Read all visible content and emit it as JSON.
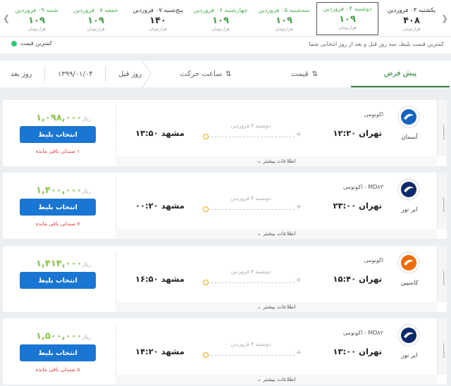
{
  "date_strip": {
    "prev_arrow": "❮",
    "next_arrow": "❯",
    "days": [
      {
        "name": "یکشنبه ۰۳ فروردین",
        "price": "۴۰۸",
        "unit": "هزارتومان",
        "dark": true,
        "selected": false
      },
      {
        "name": "دوشنبه ۰۴ فروردین",
        "price": "۱۰۹",
        "unit": "هزارتومان",
        "dark": false,
        "selected": true
      },
      {
        "name": "سه‌شنبه ۰۵ فروردین",
        "price": "۱۰۹",
        "unit": "هزارتومان",
        "dark": false,
        "selected": false
      },
      {
        "name": "چهارشنبه ۰۶ فروردین",
        "price": "۱۰۹",
        "unit": "هزارتومان",
        "dark": false,
        "selected": false
      },
      {
        "name": "پنج‌شنبه ۰۷ فروردین",
        "price": "۱۴۰",
        "unit": "هزارتومان",
        "dark": true,
        "selected": false
      },
      {
        "name": "جمعه ۰۸ فروردین",
        "price": "۱۰۹",
        "unit": "هزارتومان",
        "dark": false,
        "selected": false
      },
      {
        "name": "شنبه ۰۹ فروردین",
        "price": "۱۰۹",
        "unit": "هزارتومان",
        "dark": false,
        "selected": false
      }
    ]
  },
  "info": {
    "text": "کمترین قیمت بلیط، سه روز قبل و بعد از روز انتخابی شما",
    "cheapest_label": "کمترین قیمت"
  },
  "sort": {
    "next_day": "روز بعد",
    "date": "۱۳۹۹/۰۱/۰۴",
    "prev_day": "روز قبل",
    "tabs": {
      "time": "ساعت حرکت",
      "price": "قیمت",
      "default": "پیش فرض"
    }
  },
  "flights": [
    {
      "tag": "سیستمی",
      "airline": "آسمان",
      "class": "اکونومی",
      "dep": "تهران  ۱۲:۲۰",
      "arr": "مشهد  ۱۳:۵۰",
      "date": "دوشنبه ۴ فروردین",
      "price": "۱,۰۹۸,۰۰۰",
      "rial": "ریال",
      "select": "انتخاب بلیط",
      "seats": "۱ صندلی باقی مانده",
      "more": "اطلاعات بیشتر",
      "logo_color": "#1565c0"
    },
    {
      "tag": "سیستمی",
      "airline": "ایر تور",
      "class": "MD۸۳ - اکونومی",
      "dep": "تهران  ۲۳:۰۰",
      "arr": "مشهد  ۰۰:۲۰",
      "date": "دوشنبه ۴ فروردین",
      "price": "۱,۴۰۰,۰۰۰",
      "rial": "ریال",
      "select": "انتخاب بلیط",
      "seats": "۷ صندلی باقی مانده",
      "more": "اطلاعات بیشتر",
      "logo_color": "#0d2b6b"
    },
    {
      "tag": "سیستمی",
      "airline": "کاسپین",
      "class": "اکونومی",
      "dep": "تهران  ۱۵:۴۰",
      "arr": "مشهد  ۱۶:۵۰",
      "date": "دوشنبه ۴ فروردین",
      "price": "۱,۴۱۴,۰۰۰",
      "rial": "ریال",
      "select": "انتخاب بلیط",
      "seats": "",
      "more": "اطلاعات بیشتر",
      "logo_color": "#ef6c00"
    },
    {
      "tag": "سیستمی",
      "airline": "ایر تور",
      "class": "MD۸۲ - اکونومی",
      "dep": "تهران  ۱۳:۰۰",
      "arr": "مشهد  ۱۴:۲۰",
      "date": "دوشنبه ۴ فروردین",
      "price": "۱,۵۰۰,۰۰۰",
      "rial": "ریال",
      "select": "انتخاب بلیط",
      "seats": "۵ صندلی باقی مانده",
      "more": "اطلاعات بیشتر",
      "logo_color": "#0d2b6b"
    }
  ]
}
